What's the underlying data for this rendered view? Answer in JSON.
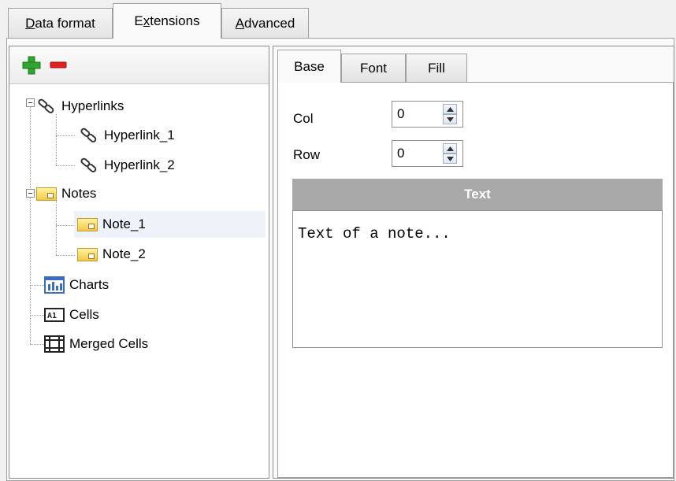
{
  "tabs": [
    {
      "pre": "",
      "ul": "D",
      "post": "ata format"
    },
    {
      "pre": "E",
      "ul": "x",
      "post": "tensions"
    },
    {
      "pre": "",
      "ul": "A",
      "post": "dvanced"
    }
  ],
  "toolbar": {
    "add_icon": "plus-icon",
    "remove_icon": "minus-icon"
  },
  "tree": {
    "hyperlinks": "Hyperlinks",
    "hyperlink_1": "Hyperlink_1",
    "hyperlink_2": "Hyperlink_2",
    "notes": "Notes",
    "note_1": "Note_1",
    "note_2": "Note_2",
    "charts": "Charts",
    "cells": "Cells",
    "merged_cells": "Merged Cells"
  },
  "subtabs": {
    "base": "Base",
    "font": "Font",
    "fill": "Fill"
  },
  "form": {
    "col_label": "Col",
    "col_value": "0",
    "row_label": "Row",
    "row_value": "0",
    "text_header": "Text",
    "note_text": "Text of a note..."
  },
  "colors": {
    "add": "#2fa52f",
    "remove": "#e02020",
    "header": "#a8a8a8",
    "selection": "#eef3fa"
  }
}
